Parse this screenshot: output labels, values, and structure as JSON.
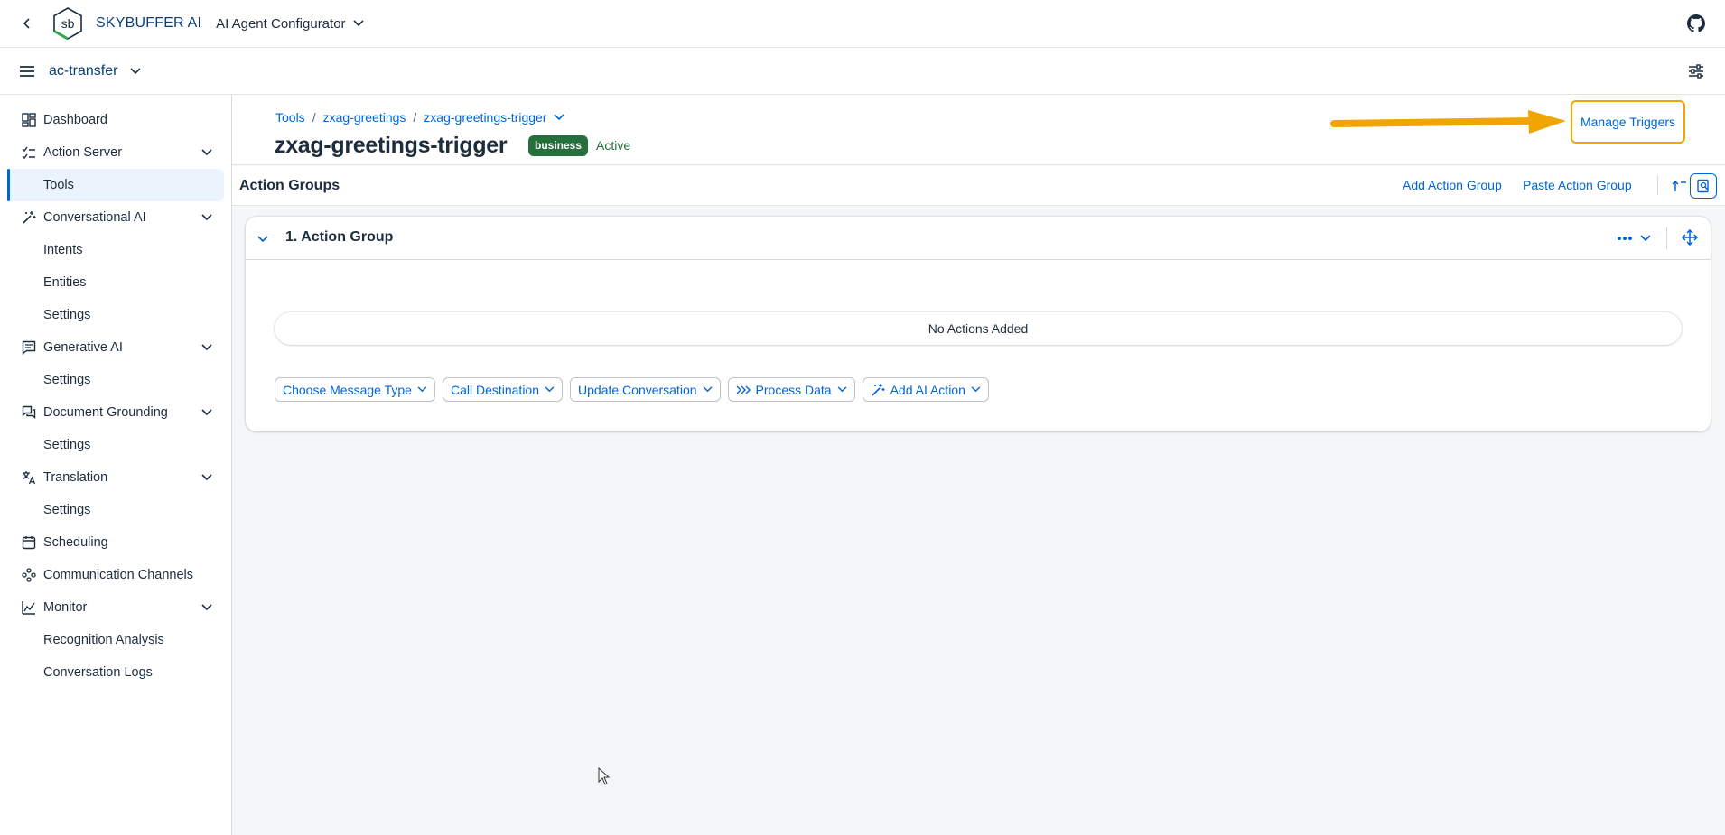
{
  "shell": {
    "brand": "SKYBUFFER AI",
    "app_title": "AI Agent Configurator",
    "logo_text": "sb"
  },
  "subheader": {
    "tenant": "ac-transfer"
  },
  "sidebar": {
    "items": [
      {
        "label": "Dashboard",
        "icon": "dashboard-icon"
      },
      {
        "label": "Action Server",
        "icon": "checklist-icon",
        "expandable": true
      },
      {
        "label": "Tools",
        "sub": true,
        "active": true
      },
      {
        "label": "Conversational AI",
        "icon": "ai-wand-icon",
        "expandable": true
      },
      {
        "label": "Intents",
        "sub": true
      },
      {
        "label": "Entities",
        "sub": true
      },
      {
        "label": "Settings",
        "sub": true
      },
      {
        "label": "Generative AI",
        "icon": "message-icon",
        "expandable": true
      },
      {
        "label": "Settings",
        "sub": true
      },
      {
        "label": "Document Grounding",
        "icon": "document-chat-icon",
        "expandable": true
      },
      {
        "label": "Settings",
        "sub": true
      },
      {
        "label": "Translation",
        "icon": "translate-icon",
        "expandable": true
      },
      {
        "label": "Settings",
        "sub": true
      },
      {
        "label": "Scheduling",
        "icon": "calendar-icon"
      },
      {
        "label": "Communication Channels",
        "icon": "network-icon"
      },
      {
        "label": "Monitor",
        "icon": "chart-icon",
        "expandable": true
      },
      {
        "label": "Recognition Analysis",
        "sub": true
      },
      {
        "label": "Conversation Logs",
        "sub": true
      }
    ]
  },
  "header": {
    "breadcrumb": [
      "Tools",
      "zxag-greetings",
      "zxag-greetings-trigger"
    ],
    "title": "zxag-greetings-trigger",
    "badge": "business",
    "status": "Active",
    "manage_triggers": "Manage Triggers"
  },
  "toolbar": {
    "title": "Action Groups",
    "add_group": "Add Action Group",
    "paste_group": "Paste Action Group"
  },
  "panel": {
    "title": "1. Action Group",
    "empty_text": "No Actions Added",
    "actions": [
      {
        "label": "Choose Message Type",
        "icon": null
      },
      {
        "label": "Call Destination",
        "icon": null
      },
      {
        "label": "Update Conversation",
        "icon": null
      },
      {
        "label": "Process Data",
        "icon": "process-icon"
      },
      {
        "label": "Add AI Action",
        "icon": "ai-wand-icon"
      }
    ]
  },
  "colors": {
    "accent": "#0064d9",
    "brand": "#0a3f7a",
    "success": "#256f3a",
    "highlight": "#f0a500"
  }
}
